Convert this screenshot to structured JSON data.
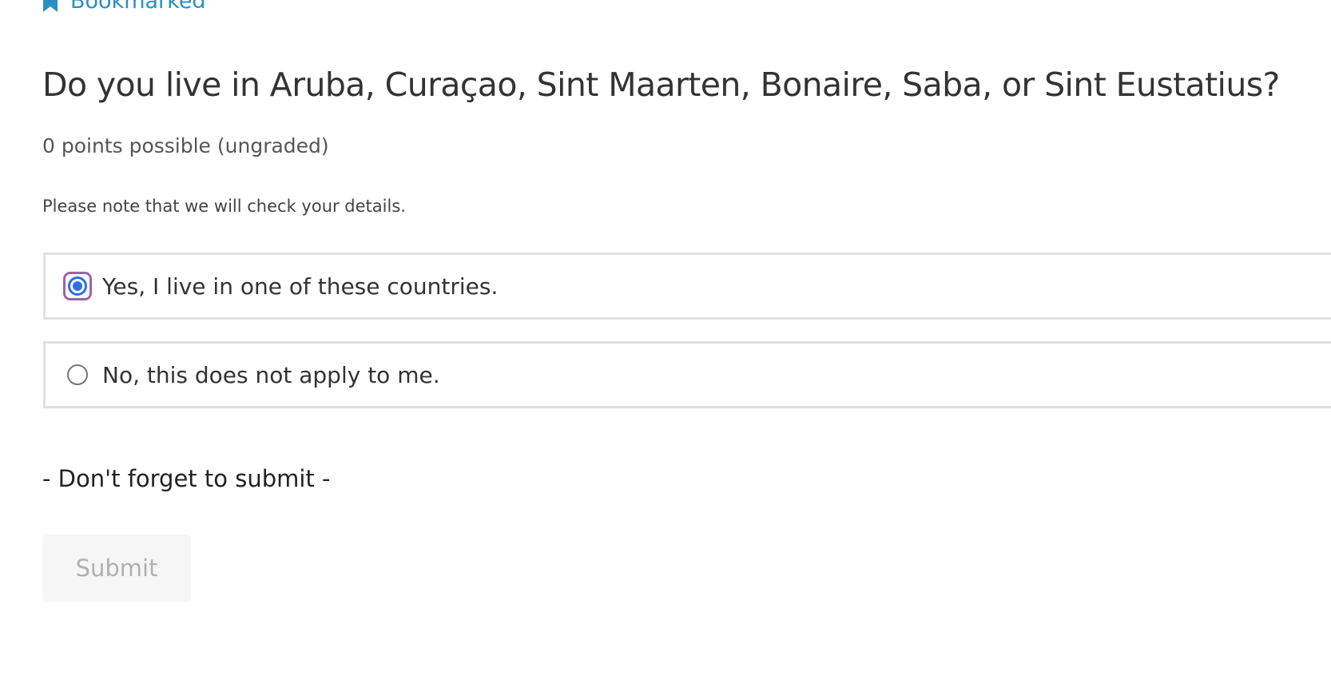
{
  "bookmark": {
    "label": "Bookmarked",
    "icon": "bookmark-icon",
    "color": "#2a8ec2"
  },
  "problem": {
    "question": "Do you live in Aruba, Curaçao, Sint Maarten, Bonaire, Saba, or Sint Eustatius?",
    "points": "0 points possible (ungraded)",
    "note": "Please note that we will check your details."
  },
  "options": [
    {
      "label": "Yes, I live in one of these countries.",
      "selected": true
    },
    {
      "label": "No, this does not apply to me.",
      "selected": false
    }
  ],
  "reminder": "- Don't forget to submit -",
  "submit": {
    "label": "Submit",
    "state": "disabled"
  },
  "colors": {
    "accent": "#2c6fe6",
    "focus_ring": "#9a64ad",
    "option_border": "#e1e1e1"
  }
}
